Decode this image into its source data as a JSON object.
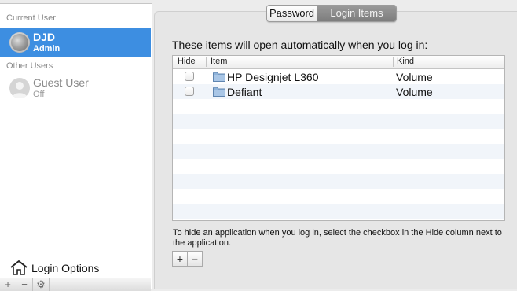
{
  "sidebar": {
    "current_user_header": "Current User",
    "current_user": {
      "name": "DJD",
      "role": "Admin"
    },
    "other_users_header": "Other Users",
    "other_users": [
      {
        "name": "Guest User",
        "status": "Off"
      }
    ],
    "login_options_label": "Login Options",
    "bottom_buttons": [
      "+",
      "−",
      "⚙"
    ]
  },
  "tabs": [
    {
      "label": "Password",
      "selected": false
    },
    {
      "label": "Login Items",
      "selected": true
    }
  ],
  "main": {
    "intro": "These items will open automatically when you log in:",
    "table": {
      "columns": [
        "Hide",
        "Item",
        "Kind"
      ],
      "rows": [
        {
          "hide": false,
          "item": "HP Designjet L360",
          "kind": "Volume",
          "icon": "folder-icon"
        },
        {
          "hide": false,
          "item": "Defiant",
          "kind": "Volume",
          "icon": "folder-icon"
        }
      ]
    },
    "hint": "To hide an application when you log in, select the checkbox in the Hide column next to the application.",
    "add_label": "+",
    "remove_label": "−"
  },
  "colors": {
    "selection": "#3d8ee1",
    "row_stripe": "#f1f5fa",
    "active_tab": "#8a8a8a"
  }
}
